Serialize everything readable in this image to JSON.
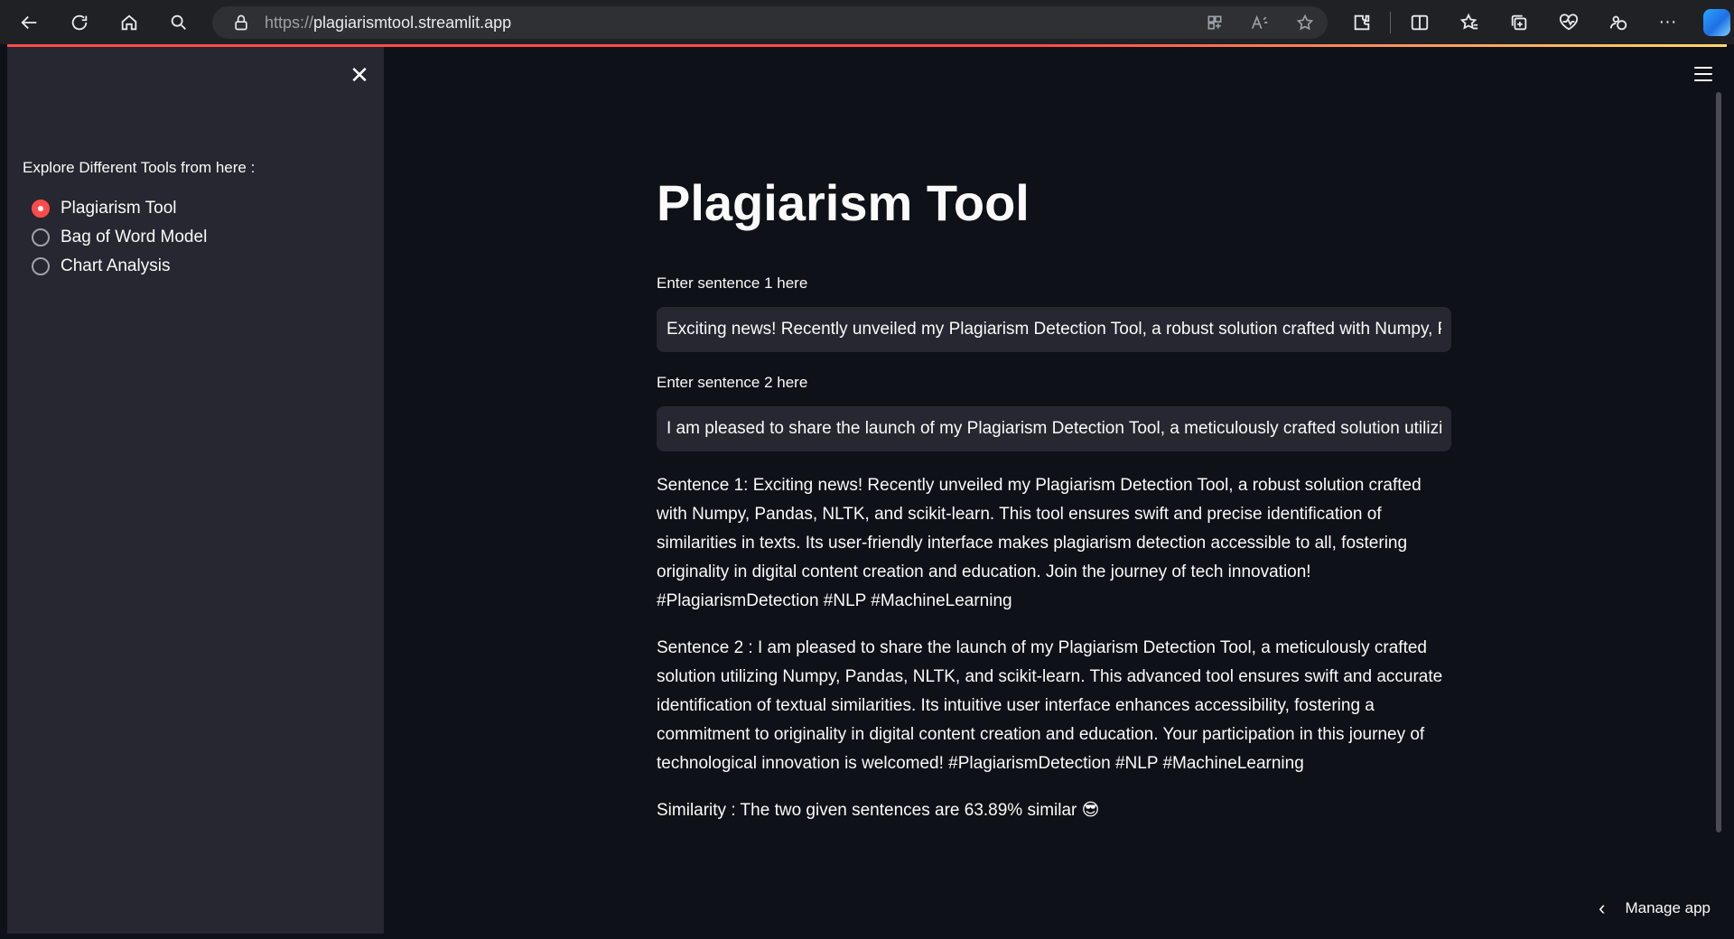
{
  "browser": {
    "url_protocol": "https://",
    "url_host": "plagiarismtool.streamlit.app",
    "more_label": "···"
  },
  "sidebar": {
    "close_label": "✕",
    "label": "Explore Different Tools from here :",
    "options": [
      {
        "label": "Plagiarism Tool",
        "checked": true
      },
      {
        "label": "Bag of Word Model",
        "checked": false
      },
      {
        "label": "Chart Analysis",
        "checked": false
      }
    ]
  },
  "main": {
    "title": "Plagiarism Tool",
    "input1": {
      "label": "Enter sentence 1 here",
      "value": "Exciting news! Recently unveiled my Plagiarism Detection Tool, a robust solution crafted with Numpy, Pandas, NLTK, and scikit-learn. This tool ensures swift and precise identification of similarities in texts."
    },
    "input2": {
      "label": "Enter sentence 2 here",
      "value": "I am pleased to share the launch of my Plagiarism Detection Tool, a meticulously crafted solution utilizing Numpy, Pandas, NLTK, and scikit-learn."
    },
    "sentence1": "Sentence 1: Exciting news! Recently unveiled my Plagiarism Detection Tool, a robust solution crafted with Numpy, Pandas, NLTK, and scikit-learn. This tool ensures swift and precise identification of similarities in texts. Its user-friendly interface makes plagiarism detection accessible to all, fostering originality in digital content creation and education. Join the journey of tech innovation! #PlagiarismDetection #NLP #MachineLearning",
    "sentence2": "Sentence 2 : I am pleased to share the launch of my Plagiarism Detection Tool, a meticulously crafted solution utilizing Numpy, Pandas, NLTK, and scikit-learn. This advanced tool ensures swift and accurate identification of textual similarities. Its intuitive user interface enhances accessibility, fostering a commitment to originality in digital content creation and education. Your participation in this journey of technological innovation is welcomed! #PlagiarismDetection #NLP #MachineLearning",
    "similarity": "Similarity : The two given sentences are 63.89% similar 😎"
  },
  "footer": {
    "manage_app_label": "Manage app",
    "chevron": "‹"
  },
  "colors": {
    "accent": "#ff4b4b",
    "background": "#0e1117",
    "sidebar": "#262730"
  }
}
